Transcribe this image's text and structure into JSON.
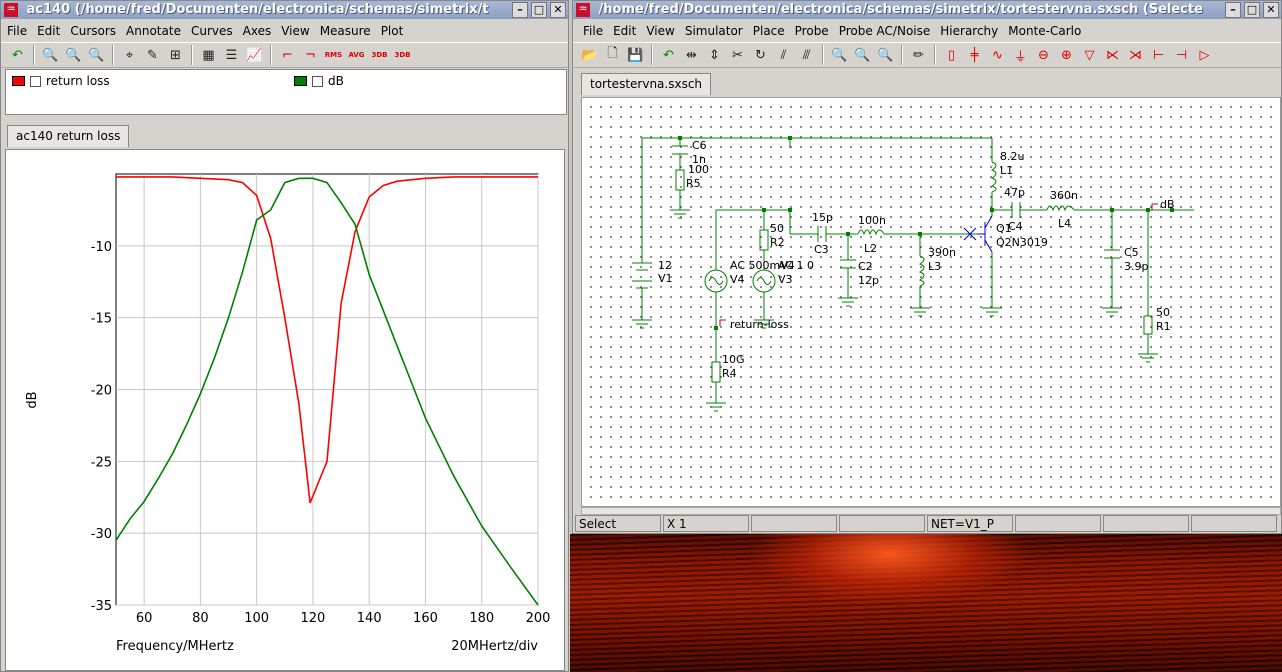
{
  "left_window": {
    "title": "ac140 (/home/fred/Documenten/electronica/schemas/simetrix/t",
    "menu": [
      "File",
      "Edit",
      "Cursors",
      "Annotate",
      "Curves",
      "Axes",
      "View",
      "Measure",
      "Plot"
    ],
    "legend": [
      {
        "label": "return loss",
        "color": "#ff0000"
      },
      {
        "label": "dB",
        "color": "#008000"
      }
    ],
    "tab": "ac140 return loss",
    "toolbar_text": {
      "rms": "RMS",
      "avg": "AVG",
      "db1": "3DB",
      "db2": "3DB"
    }
  },
  "right_window": {
    "title": "/home/fred/Documenten/electronica/schemas/simetrix/tortestervna.sxsch (Selecte",
    "menu": [
      "File",
      "Edit",
      "View",
      "Simulator",
      "Place",
      "Probe",
      "Probe AC/Noise",
      "Hierarchy",
      "Monte-Carlo"
    ],
    "tab": "tortestervna.sxsch",
    "status": [
      "Select",
      "X     1",
      "",
      "",
      "NET=V1_P",
      "",
      "",
      ""
    ]
  },
  "schematic": {
    "labels": {
      "c6": "C6",
      "c6v": "1n",
      "r5v": "100",
      "r5": "R5",
      "v1v": "12",
      "v1": "V1",
      "r2v": "50",
      "r2": "R2",
      "v4": "AC 500mV4",
      "v3": "AC 1 0",
      "v3n": "V3",
      "v4n": "V4",
      "c3v": "15p",
      "c3": "C3",
      "l2v": "100n",
      "l2": "L2",
      "c2": "C2",
      "c2v": "12p",
      "l3v": "390n",
      "l3": "L3",
      "l1v": "8.2u",
      "l1": "L1",
      "q1": "Q1",
      "q1m": "Q2N3019",
      "c4v": "47p",
      "c4": "C4",
      "l4v": "360n",
      "l4": "L4",
      "c5": "C5",
      "c5v": "3.9p",
      "r1v": "50",
      "r1": "R1",
      "db": "dB",
      "rl": "return-loss",
      "r4v": "10G",
      "r4": "R4"
    }
  },
  "chart_data": {
    "type": "line",
    "title": "",
    "xlabel": "Frequency/MHertz",
    "ylabel": "dB",
    "x_note": "20MHertz/div",
    "xlim": [
      50,
      200
    ],
    "ylim": [
      -35,
      -5
    ],
    "xticks": [
      60,
      80,
      100,
      120,
      140,
      160,
      180,
      200
    ],
    "yticks": [
      -10,
      -15,
      -20,
      -25,
      -30,
      -35
    ],
    "grid": true,
    "series": [
      {
        "name": "return loss",
        "color": "#ff0000",
        "x": [
          50,
          60,
          70,
          80,
          90,
          95,
          100,
          105,
          110,
          115,
          119,
          125,
          130,
          135,
          140,
          145,
          150,
          160,
          170,
          180,
          190,
          200
        ],
        "y": [
          -5.2,
          -5.2,
          -5.2,
          -5.3,
          -5.4,
          -5.6,
          -6.5,
          -9.5,
          -15,
          -21,
          -27.9,
          -25,
          -14,
          -9,
          -6.6,
          -5.8,
          -5.5,
          -5.3,
          -5.2,
          -5.2,
          -5.2,
          -5.2
        ]
      },
      {
        "name": "dB",
        "color": "#008000",
        "x": [
          50,
          55,
          60,
          65,
          70,
          75,
          80,
          85,
          90,
          95,
          100,
          105,
          110,
          115,
          120,
          125,
          130,
          135,
          140,
          150,
          160,
          170,
          180,
          190,
          200
        ],
        "y": [
          -30.5,
          -29,
          -27.8,
          -26.2,
          -24.5,
          -22.5,
          -20.3,
          -17.8,
          -15,
          -11.8,
          -8.2,
          -7.5,
          -5.6,
          -5.3,
          -5.3,
          -5.6,
          -7,
          -8.5,
          -12,
          -17,
          -22,
          -26,
          -29.5,
          -32.3,
          -35
        ]
      }
    ]
  }
}
